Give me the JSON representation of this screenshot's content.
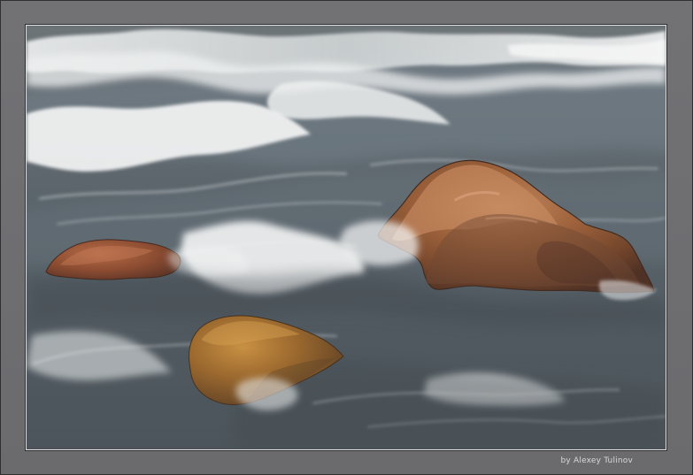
{
  "photo": {
    "credit": "by Alexey Tulinov"
  }
}
